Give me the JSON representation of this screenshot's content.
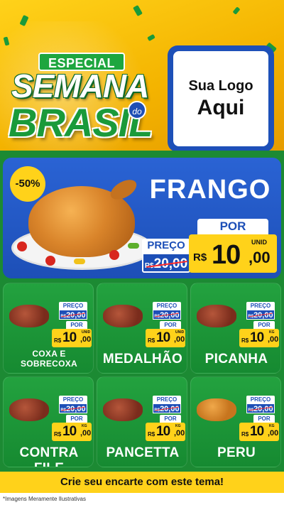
{
  "header": {
    "badge": "ESPECIAL",
    "title_line1": "SEMANA",
    "title_do": "do",
    "title_line2": "BRASIL",
    "logo_line1": "Sua Logo",
    "logo_line2": "Aqui"
  },
  "hero": {
    "discount": "-50%",
    "name": "FRANGO",
    "preco_label": "PREÇO",
    "old_currency": "R$",
    "old_price": "20,00",
    "por_label": "POR",
    "currency": "R$",
    "price_int": "10",
    "price_dec": ",00",
    "unit": "UNID"
  },
  "products": [
    {
      "name": "COXA E SOBRECOXA",
      "preco_label": "PREÇO",
      "old_currency": "R$",
      "old_price": "20,00",
      "por_label": "POR",
      "currency": "R$",
      "price_int": "10",
      "price_dec": ",00",
      "unit": "UNID"
    },
    {
      "name": "MEDALHÃO",
      "preco_label": "PREÇO",
      "old_currency": "R$",
      "old_price": "20,00",
      "por_label": "POR",
      "currency": "R$",
      "price_int": "10",
      "price_dec": ",00",
      "unit": "UNID"
    },
    {
      "name": "PICANHA",
      "preco_label": "PREÇO",
      "old_currency": "R$",
      "old_price": "20,00",
      "por_label": "POR",
      "currency": "R$",
      "price_int": "10",
      "price_dec": ",00",
      "unit": "KG"
    },
    {
      "name": "CONTRA FILE",
      "preco_label": "PREÇO",
      "old_currency": "R$",
      "old_price": "20,00",
      "por_label": "POR",
      "currency": "R$",
      "price_int": "10",
      "price_dec": ",00",
      "unit": "KG"
    },
    {
      "name": "PANCETTA",
      "preco_label": "PREÇO",
      "old_currency": "R$",
      "old_price": "20,00",
      "por_label": "POR",
      "currency": "R$",
      "price_int": "10",
      "price_dec": ",00",
      "unit": "KG"
    },
    {
      "name": "PERU",
      "preco_label": "PREÇO",
      "old_currency": "R$",
      "old_price": "20,00",
      "por_label": "POR",
      "currency": "R$",
      "price_int": "10",
      "price_dec": ",00",
      "unit": "KG"
    }
  ],
  "footer": {
    "cta": "Crie seu encarte com este tema!",
    "note": "*Imagens Meramente Ilustrativas"
  },
  "colors": {
    "yellow": "#ffd21a",
    "green": "#1c8a33",
    "blue": "#1d4fb7",
    "white": "#ffffff"
  }
}
